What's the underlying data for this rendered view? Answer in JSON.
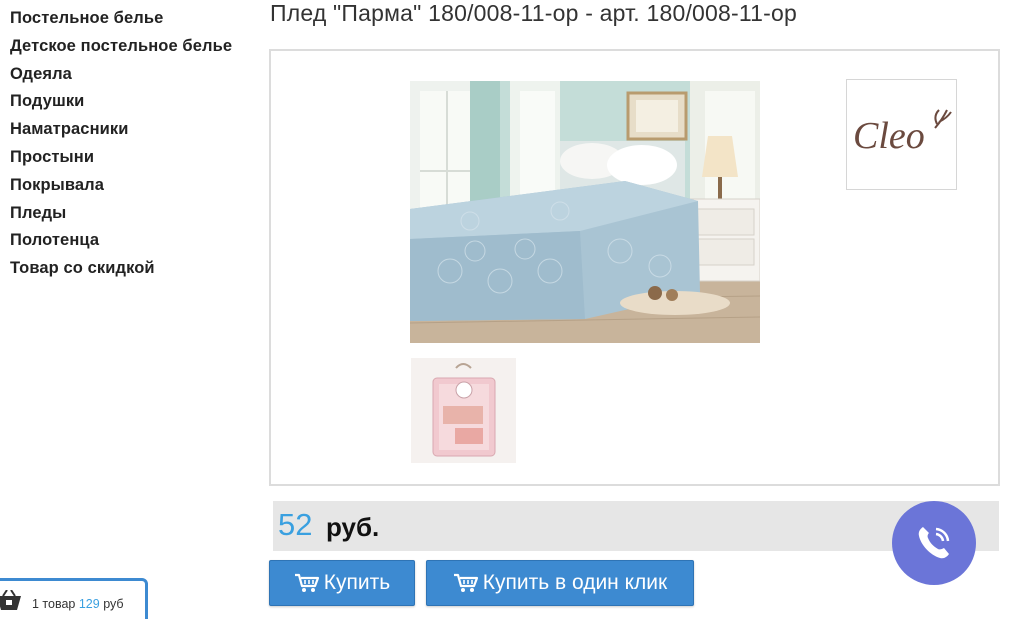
{
  "sidebar": {
    "items": [
      {
        "label": "Постельное белье"
      },
      {
        "label": "Детское постельное белье"
      },
      {
        "label": "Одеяла"
      },
      {
        "label": "Подушки"
      },
      {
        "label": "Наматрасники"
      },
      {
        "label": "Простыни"
      },
      {
        "label": "Покрывала"
      },
      {
        "label": "Пледы"
      },
      {
        "label": "Полотенца"
      },
      {
        "label": "Товар со скидкой"
      }
    ]
  },
  "product": {
    "title": "Плед \"Парма\" 180/008-11-ор - арт. 180/008-11-ор",
    "brand_logo_text": "Cleo",
    "price_value": "52",
    "price_unit": "руб."
  },
  "buttons": {
    "buy_label": "Купить",
    "quick_buy_label": "Купить в один клик",
    "icon": "cart-icon"
  },
  "mini_cart": {
    "count_text": "1 товар",
    "sum_value": "129",
    "sum_unit": "руб"
  },
  "colors": {
    "accent": "#3d8ad1",
    "price": "#3aa0e0",
    "viber": "#6b75d8"
  }
}
